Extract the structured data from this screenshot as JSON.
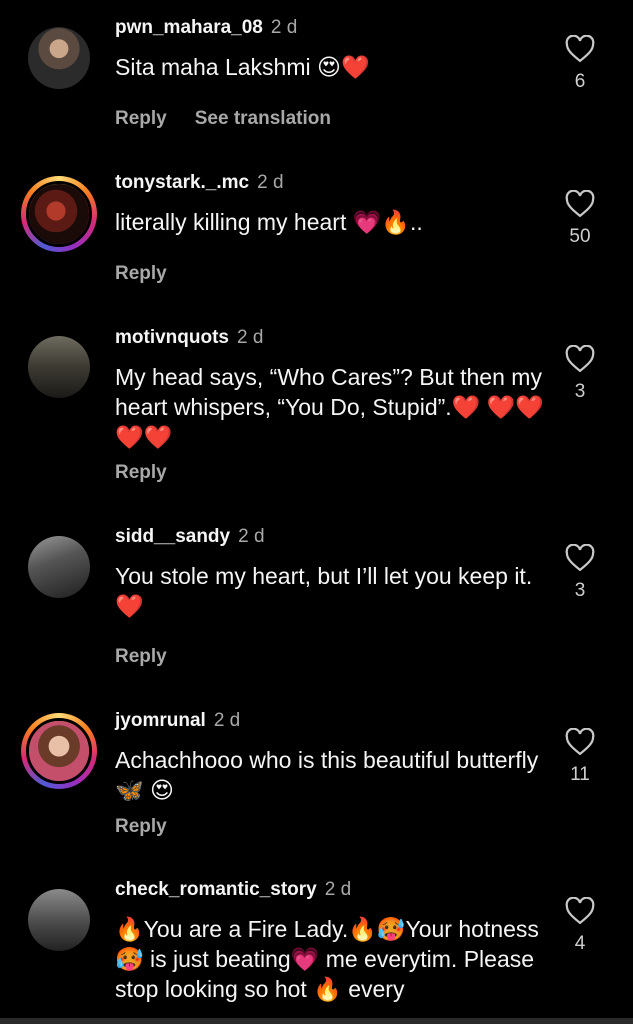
{
  "comments": [
    {
      "username": "pwn_mahara_08",
      "time": "2 d",
      "text": "Sita maha Lakshmi 😍❤️",
      "actions": [
        "Reply",
        "See translation"
      ],
      "likes": "6"
    },
    {
      "username": "tonystark._.mc",
      "time": "2 d",
      "text": "literally killing my heart 💗🔥..",
      "actions": [
        "Reply"
      ],
      "likes": "50"
    },
    {
      "username": "motivnquots",
      "time": "2 d",
      "text": "My head says, “Who Cares”? But then my heart whispers, “You Do, Stupid”.❤️ ❤️❤️❤️❤️",
      "actions": [
        "Reply"
      ],
      "likes": "3"
    },
    {
      "username": "sidd__sandy",
      "time": "2 d",
      "text": "You stole my heart, but I’ll let you keep it.❤️",
      "actions": [
        "Reply"
      ],
      "likes": "3"
    },
    {
      "username": "jyomrunal",
      "time": "2 d",
      "text": "Achachhooo who is this beautiful butterfly 🦋 😍",
      "actions": [
        "Reply"
      ],
      "likes": "11"
    },
    {
      "username": "check_romantic_story",
      "time": "2 d",
      "text": "🔥You are a Fire Lady.🔥🥵Your hotness🥵 is just beating💗 me everytim. Please stop looking so hot 🔥 every",
      "actions": [],
      "likes": "4"
    }
  ],
  "colors": {
    "background": "#000000",
    "text": "#f5f5f5",
    "secondary": "#a8a8a8"
  }
}
